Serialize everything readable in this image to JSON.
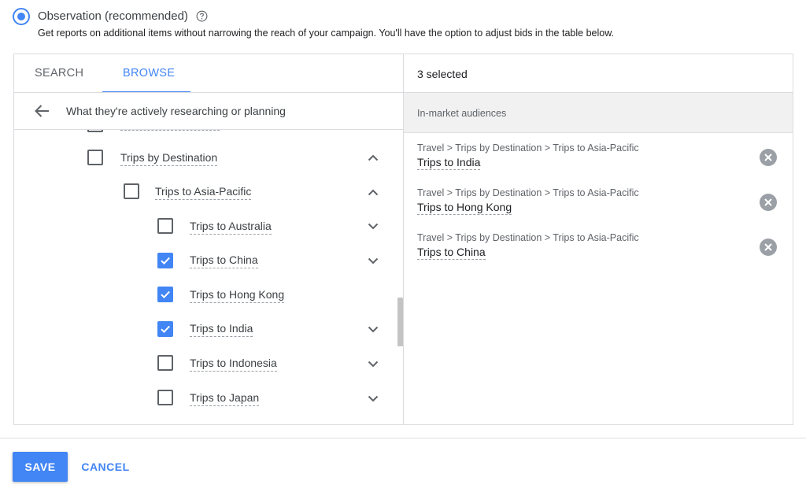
{
  "targeting_option": {
    "title": "Observation (recommended)",
    "description": "Get reports on additional items without narrowing the reach of your campaign. You'll have the option to adjust bids in the table below.",
    "selected": true,
    "help_icon": "help-circle-icon"
  },
  "tabs": [
    {
      "label": "SEARCH",
      "active": false
    },
    {
      "label": "BROWSE",
      "active": true
    }
  ],
  "browse": {
    "back_label": "What they're actively researching or planning",
    "back_icon": "arrow-back-icon",
    "tree": [
      {
        "label": "Trips by Destination",
        "checked": false,
        "level": 1,
        "chevron": "up"
      },
      {
        "label": "Trips to Asia-Pacific",
        "checked": false,
        "level": 2,
        "chevron": "up"
      },
      {
        "label": "Trips to Australia",
        "checked": false,
        "level": 3,
        "chevron": "down"
      },
      {
        "label": "Trips to China",
        "checked": true,
        "level": 3,
        "chevron": "down"
      },
      {
        "label": "Trips to Hong Kong",
        "checked": true,
        "level": 3,
        "chevron": "none"
      },
      {
        "label": "Trips to India",
        "checked": true,
        "level": 3,
        "chevron": "down"
      },
      {
        "label": "Trips to Indonesia",
        "checked": false,
        "level": 3,
        "chevron": "down"
      },
      {
        "label": "Trips to Japan",
        "checked": false,
        "level": 3,
        "chevron": "down"
      }
    ]
  },
  "selected_panel": {
    "count_label": "3 selected",
    "section_header": "In-market audiences",
    "items": [
      {
        "path": "Travel > Trips by Destination > Trips to Asia-Pacific",
        "name": "Trips to India"
      },
      {
        "path": "Travel > Trips by Destination > Trips to Asia-Pacific",
        "name": "Trips to Hong Kong"
      },
      {
        "path": "Travel > Trips by Destination > Trips to Asia-Pacific",
        "name": "Trips to China"
      }
    ]
  },
  "footer": {
    "save_label": "SAVE",
    "cancel_label": "CANCEL"
  },
  "colors": {
    "accent": "#4285f4",
    "text": "#3c4043",
    "muted": "#5f6368",
    "section_bg": "#f1f1f1",
    "remove_icon_bg": "#9aa0a6"
  }
}
